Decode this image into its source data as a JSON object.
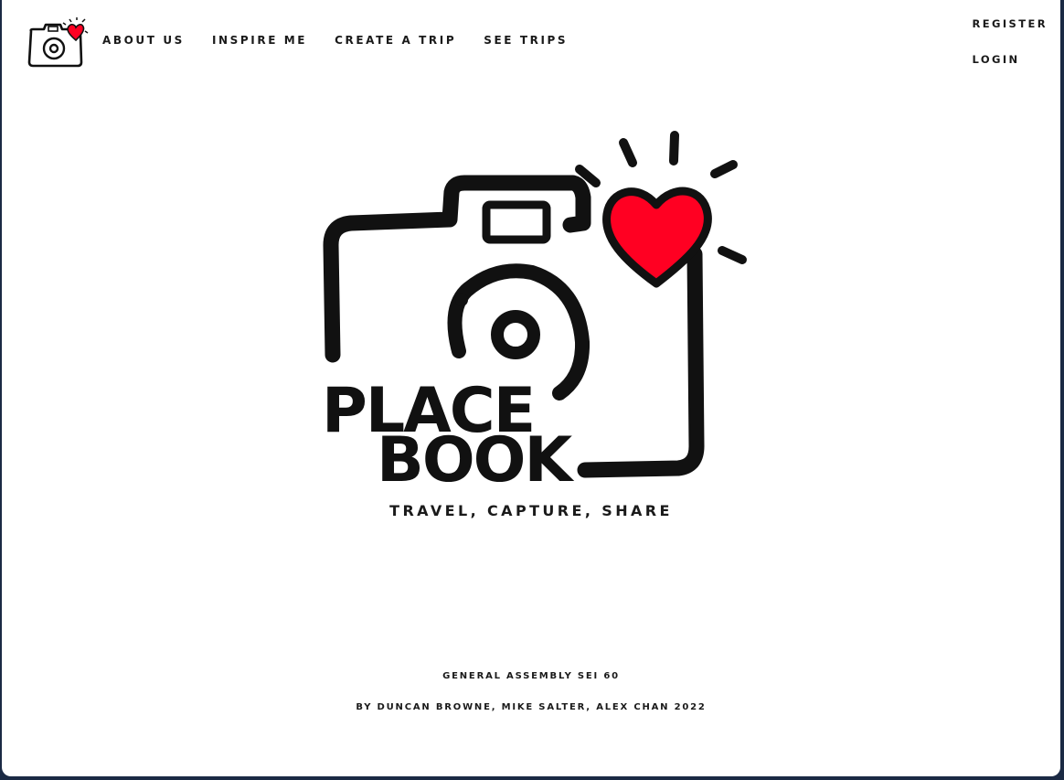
{
  "nav": {
    "logo_icon": "camera-heart-icon",
    "links": [
      "About us",
      "Inspire me",
      "Create a trip",
      "See trips"
    ],
    "auth": [
      "Register",
      "Login"
    ]
  },
  "hero": {
    "logo_icon": "camera-heart-logo",
    "brand_line1": "PLACE",
    "brand_line2": "BOOK",
    "tagline": "Travel, capture, share"
  },
  "footer": {
    "line1": "General Assembly SEI 60",
    "line2": "By Duncan Browne, Mike Salter, Alex Chan 2022"
  },
  "colors": {
    "accent_heart": "#ff0022",
    "ink": "#111111",
    "background": "#ffffff"
  }
}
